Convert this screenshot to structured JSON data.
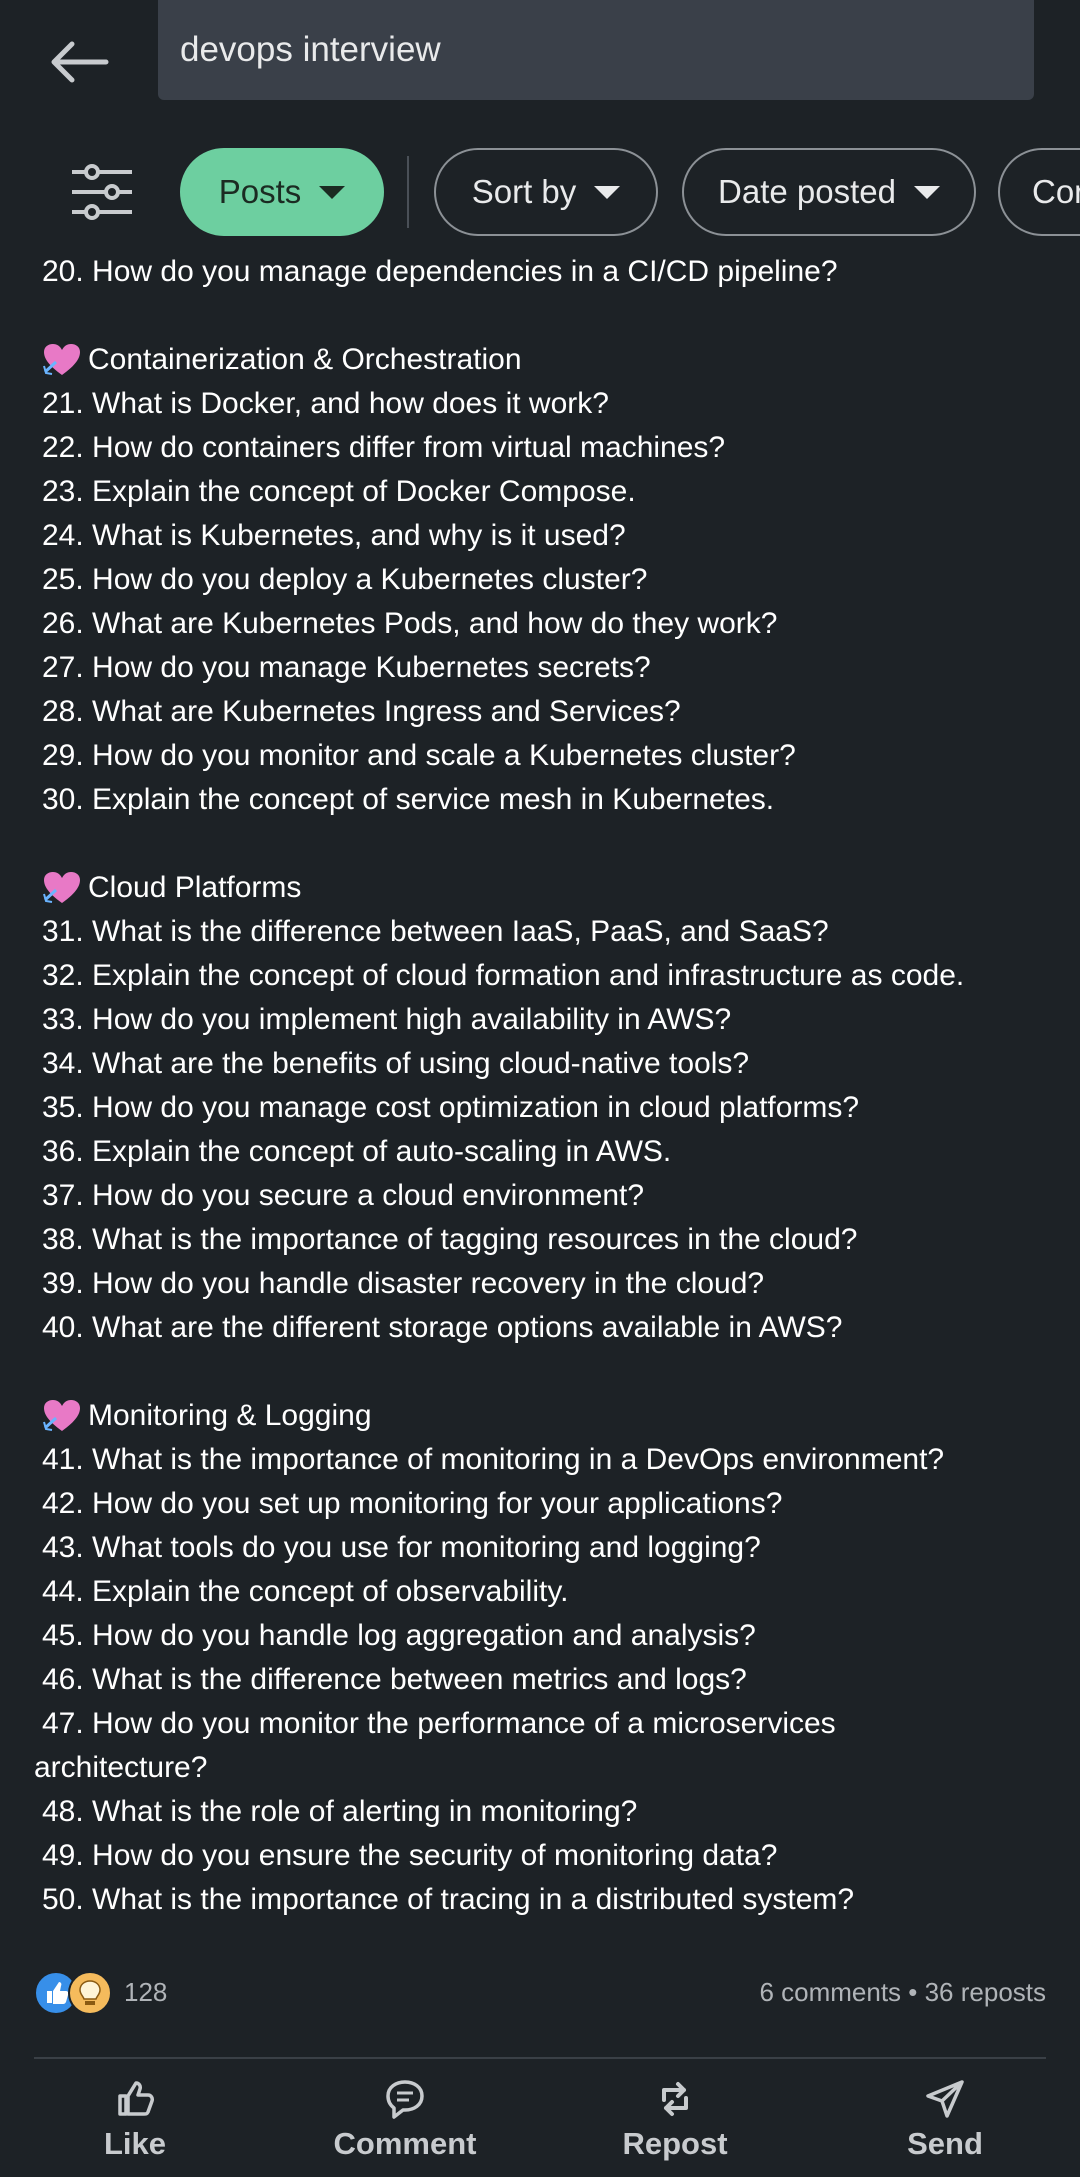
{
  "search": {
    "query": "devops interview"
  },
  "filters": {
    "chips": [
      {
        "label": "Posts"
      },
      {
        "label": "Sort by"
      },
      {
        "label": "Date posted"
      },
      {
        "label": "Con"
      }
    ]
  },
  "post": {
    "lines_top": [
      "20. How do you manage dependencies in a CI/CD pipeline?"
    ],
    "sections": [
      {
        "title": "Containerization & Orchestration",
        "items": [
          "21. What is Docker, and how does it work?",
          "22. How do containers differ from virtual machines?",
          "23. Explain the concept of Docker Compose.",
          "24. What is Kubernetes, and why is it used?",
          "25. How do you deploy a Kubernetes cluster?",
          "26. What are Kubernetes Pods, and how do they work?",
          "27. How do you manage Kubernetes secrets?",
          "28. What are Kubernetes Ingress and Services?",
          "29. How do you monitor and scale a Kubernetes cluster?",
          "30. Explain the concept of service mesh in Kubernetes."
        ]
      },
      {
        "title": "Cloud Platforms",
        "items": [
          "31. What is the difference between IaaS, PaaS, and SaaS?",
          "32. Explain the concept of cloud formation and infrastructure as code.",
          "33. How do you implement high availability in AWS?",
          "34. What are the benefits of using cloud-native tools?",
          "35. How do you manage cost optimization in cloud platforms?",
          "36. Explain the concept of auto-scaling in AWS.",
          "37. How do you secure a cloud environment?",
          "38. What is the importance of tagging resources in the cloud?",
          "39. How do you handle disaster recovery in the cloud?",
          "40. What are the different storage options available in AWS?"
        ]
      },
      {
        "title": "Monitoring & Logging",
        "items": [
          "41. What is the importance of monitoring in a DevOps environment?",
          "42. How do you set up monitoring for your applications?",
          "43. What tools do you use for monitoring and logging?",
          "44. Explain the concept of observability.",
          "45. How do you handle log aggregation and analysis?",
          "46. What is the difference between metrics and logs?",
          "47. How do you monitor the performance of a microservices",
          "architecture?",
          "48. What is the role of alerting in monitoring?",
          "49. How do you ensure the security of monitoring data?",
          "50. What is the importance of tracing in a distributed system?"
        ]
      }
    ]
  },
  "social": {
    "reaction_count": "128",
    "stats": "6 comments • 36 reposts"
  },
  "actions": {
    "like": "Like",
    "comment": "Comment",
    "repost": "Repost",
    "send": "Send"
  },
  "colors": {
    "background": "#1d2226",
    "accent": "#6dcfa0",
    "search_bg": "#3a4049"
  }
}
